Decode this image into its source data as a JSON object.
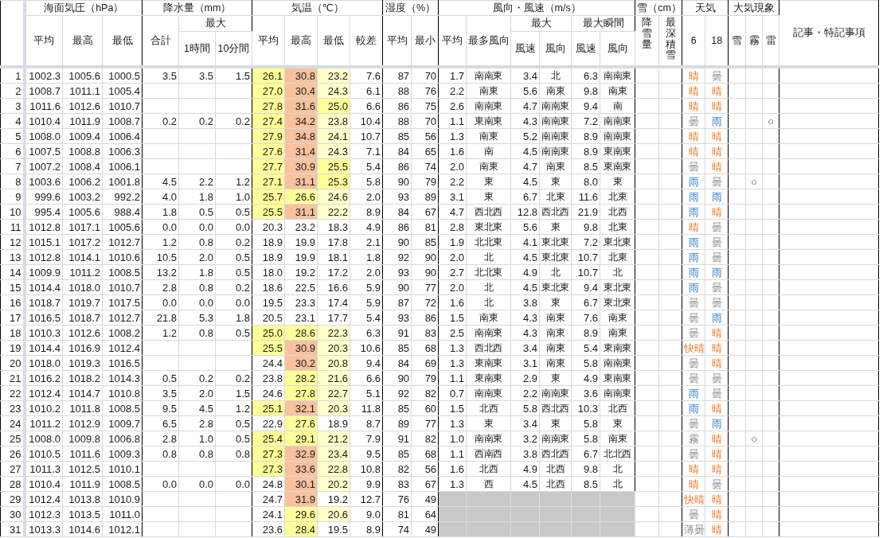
{
  "columns": {
    "pressure": {
      "title": "海面気圧（hPa）",
      "sub": [
        "平均",
        "最高",
        "最低"
      ]
    },
    "precipitation": {
      "title": "降水量（mm）",
      "total": "合計",
      "max": {
        "title": "最大",
        "sub": [
          "1時間",
          "10分間"
        ]
      }
    },
    "temperature": {
      "title": "気温（℃）",
      "sub": [
        "平均",
        "最高",
        "最低",
        "較差"
      ]
    },
    "humidity": {
      "title": "湿度（%）",
      "sub": [
        "平均",
        "最小"
      ]
    },
    "wind": {
      "title": "風向・風速（m/s）",
      "average": "平均",
      "prevailing": "最多風向",
      "max": {
        "title": "最大",
        "sub": [
          "風速",
          "風向"
        ]
      },
      "gust": {
        "title": "最大瞬間",
        "sub": [
          "風速",
          "風向"
        ]
      }
    },
    "snow": {
      "title": "雪（cm）",
      "sub": [
        "降雪量",
        "最深積雪"
      ]
    },
    "weather": {
      "title": "天気",
      "sub": [
        "6",
        "18"
      ]
    },
    "phenomena": {
      "title": "大気現象",
      "sub": [
        "雪",
        "霧",
        "雷"
      ]
    },
    "notes": {
      "title": "記事・特記事項"
    }
  },
  "rows": [
    {
      "day": "1",
      "pressure": [
        "1002.3",
        "1005.6",
        "1000.5"
      ],
      "precipitation": [
        "3.5",
        "3.5",
        "1.5"
      ],
      "temperature": [
        {
          "text": "26.1",
          "color": "#ffff99"
        },
        {
          "text": "30.8",
          "color": "#f8c29f"
        },
        {
          "text": "23.2",
          "color": "#ffffcc"
        },
        {
          "text": "7.6"
        }
      ],
      "humidity": [
        "87",
        "70"
      ],
      "wind_missing": false,
      "wind": [
        "1.7",
        "南南東",
        "3.4",
        "北",
        "6.3",
        "南南東"
      ],
      "weather": [
        {
          "text": "晴",
          "kind": "fair"
        },
        {
          "text": "曇",
          "kind": "cloudy"
        }
      ]
    },
    {
      "day": "2",
      "pressure": [
        "1008.7",
        "1011.1",
        "1005.4"
      ],
      "temperature": [
        {
          "text": "27.0",
          "color": "#ffff99"
        },
        {
          "text": "30.4",
          "color": "#f8c29f"
        },
        {
          "text": "24.3",
          "color": "#ffffcc"
        },
        {
          "text": "6.1"
        }
      ],
      "humidity": [
        "88",
        "76"
      ],
      "wind_missing": false,
      "wind": [
        "2.2",
        "南東",
        "5.6",
        "南東",
        "9.8",
        "南東"
      ],
      "weather": [
        {
          "text": "晴",
          "kind": "fair"
        },
        {
          "text": "晴",
          "kind": "fair"
        }
      ]
    },
    {
      "day": "3",
      "pressure": [
        "1011.6",
        "1012.6",
        "1010.7"
      ],
      "temperature": [
        {
          "text": "27.8",
          "color": "#ffff99"
        },
        {
          "text": "31.6",
          "color": "#f8c29f"
        },
        {
          "text": "25.0",
          "color": "#ffff99"
        },
        {
          "text": "6.6"
        }
      ],
      "humidity": [
        "86",
        "75"
      ],
      "wind_missing": false,
      "wind": [
        "2.6",
        "南南東",
        "4.7",
        "南南東",
        "9.4",
        "南"
      ],
      "weather": [
        {
          "text": "晴",
          "kind": "fair"
        },
        {
          "text": "晴",
          "kind": "fair"
        }
      ]
    },
    {
      "day": "4",
      "pressure": [
        "1010.4",
        "1011.9",
        "1008.7"
      ],
      "precipitation": [
        "0.2",
        "0.2",
        "0.2"
      ],
      "temperature": [
        {
          "text": "27.4",
          "color": "#ffff99"
        },
        {
          "text": "34.2",
          "color": "#f8c29f"
        },
        {
          "text": "23.8",
          "color": "#ffffcc"
        },
        {
          "text": "10.4"
        }
      ],
      "humidity": [
        "88",
        "70"
      ],
      "wind_missing": false,
      "wind": [
        "1.1",
        "東南東",
        "4.3",
        "南南東",
        "7.2",
        "南南東"
      ],
      "weather": [
        {
          "text": "曇",
          "kind": "cloudy"
        },
        {
          "text": "雨",
          "kind": "rain"
        }
      ],
      "phenomena": {
        "thunder": "○"
      }
    },
    {
      "day": "5",
      "pressure": [
        "1008.0",
        "1009.4",
        "1006.4"
      ],
      "temperature": [
        {
          "text": "27.9",
          "color": "#ffff99"
        },
        {
          "text": "34.8",
          "color": "#f8c29f"
        },
        {
          "text": "24.1",
          "color": "#ffffcc"
        },
        {
          "text": "10.7"
        }
      ],
      "humidity": [
        "85",
        "56"
      ],
      "wind_missing": false,
      "wind": [
        "1.3",
        "南東",
        "5.2",
        "南南東",
        "8.9",
        "南南東"
      ],
      "weather": [
        {
          "text": "晴",
          "kind": "fair"
        },
        {
          "text": "晴",
          "kind": "fair"
        }
      ]
    },
    {
      "day": "6",
      "pressure": [
        "1007.5",
        "1008.8",
        "1006.3"
      ],
      "temperature": [
        {
          "text": "27.6",
          "color": "#ffff99"
        },
        {
          "text": "31.4",
          "color": "#f8c29f"
        },
        {
          "text": "24.3",
          "color": "#ffffcc"
        },
        {
          "text": "7.1"
        }
      ],
      "humidity": [
        "84",
        "65"
      ],
      "wind_missing": false,
      "wind": [
        "1.6",
        "南",
        "4.5",
        "南南東",
        "8.9",
        "東南東"
      ],
      "weather": [
        {
          "text": "晴",
          "kind": "fair"
        },
        {
          "text": "晴",
          "kind": "fair"
        }
      ]
    },
    {
      "day": "7",
      "pressure": [
        "1007.2",
        "1008.4",
        "1006.1"
      ],
      "temperature": [
        {
          "text": "27.7",
          "color": "#ffff99"
        },
        {
          "text": "30.9",
          "color": "#f8c29f"
        },
        {
          "text": "25.5",
          "color": "#ffff99"
        },
        {
          "text": "5.4"
        }
      ],
      "humidity": [
        "86",
        "74"
      ],
      "wind_missing": false,
      "wind": [
        "2.0",
        "南東",
        "4.7",
        "南東",
        "8.5",
        "東南東"
      ],
      "weather": [
        {
          "text": "曇",
          "kind": "cloudy"
        },
        {
          "text": "晴",
          "kind": "fair"
        }
      ]
    },
    {
      "day": "8",
      "pressure": [
        "1003.6",
        "1006.2",
        "1001.8"
      ],
      "precipitation": [
        "4.5",
        "2.2",
        "1.2"
      ],
      "temperature": [
        {
          "text": "27.1",
          "color": "#ffff99"
        },
        {
          "text": "31.1",
          "color": "#f8c29f"
        },
        {
          "text": "25.3",
          "color": "#ffff99"
        },
        {
          "text": "5.8"
        }
      ],
      "humidity": [
        "90",
        "79"
      ],
      "wind_missing": false,
      "wind": [
        "2.2",
        "東",
        "4.5",
        "東",
        "8.0",
        "東"
      ],
      "weather": [
        {
          "text": "雨",
          "kind": "rain"
        },
        {
          "text": "曇",
          "kind": "cloudy"
        }
      ],
      "phenomena": {
        "fog": "○"
      }
    },
    {
      "day": "9",
      "pressure": [
        "999.6",
        "1003.2",
        "992.2"
      ],
      "precipitation": [
        "4.0",
        "1.8",
        "1.0"
      ],
      "temperature": [
        {
          "text": "25.7",
          "color": "#ffff99"
        },
        {
          "text": "26.6",
          "color": "#ffff99"
        },
        {
          "text": "24.6",
          "color": "#ffffcc"
        },
        {
          "text": "2.0"
        }
      ],
      "humidity": [
        "93",
        "89"
      ],
      "wind_missing": false,
      "wind": [
        "3.1",
        "東",
        "6.7",
        "北東",
        "11.6",
        "北東"
      ],
      "weather": [
        {
          "text": "雨",
          "kind": "rain"
        },
        {
          "text": "雨",
          "kind": "rain"
        }
      ]
    },
    {
      "day": "10",
      "pressure": [
        "995.4",
        "1005.6",
        "988.4"
      ],
      "precipitation": [
        "1.8",
        "0.5",
        "0.5"
      ],
      "temperature": [
        {
          "text": "25.5",
          "color": "#ffff99"
        },
        {
          "text": "31.1",
          "color": "#f8c29f"
        },
        {
          "text": "22.2",
          "color": "#ffffcc"
        },
        {
          "text": "8.9"
        }
      ],
      "humidity": [
        "84",
        "67"
      ],
      "wind_missing": false,
      "wind": [
        "4.7",
        "西北西",
        "12.8",
        "西北西",
        "21.9",
        "北西"
      ],
      "weather": [
        {
          "text": "雨",
          "kind": "rain"
        },
        {
          "text": "晴",
          "kind": "fair"
        }
      ]
    },
    {
      "day": "11",
      "pressure": [
        "1012.8",
        "1017.1",
        "1005.6"
      ],
      "precipitation": [
        "0.0",
        "0.0",
        "0.0"
      ],
      "temperature": [
        {
          "text": "20.3"
        },
        {
          "text": "23.2"
        },
        {
          "text": "18.3"
        },
        {
          "text": "4.9"
        }
      ],
      "humidity": [
        "86",
        "81"
      ],
      "wind_missing": false,
      "wind": [
        "2.8",
        "東北東",
        "5.6",
        "東",
        "9.8",
        "北東"
      ],
      "weather": [
        {
          "text": "晴",
          "kind": "fair"
        },
        {
          "text": "曇",
          "kind": "cloudy"
        }
      ]
    },
    {
      "day": "12",
      "pressure": [
        "1015.1",
        "1017.2",
        "1012.7"
      ],
      "precipitation": [
        "1.2",
        "0.8",
        "0.2"
      ],
      "temperature": [
        {
          "text": "18.9"
        },
        {
          "text": "19.9"
        },
        {
          "text": "17.8"
        },
        {
          "text": "2.1"
        }
      ],
      "humidity": [
        "90",
        "85"
      ],
      "wind_missing": false,
      "wind": [
        "1.9",
        "北北東",
        "4.1",
        "東北東",
        "7.2",
        "東北東"
      ],
      "weather": [
        {
          "text": "雨",
          "kind": "rain"
        },
        {
          "text": "曇",
          "kind": "cloudy"
        }
      ]
    },
    {
      "day": "13",
      "pressure": [
        "1012.8",
        "1014.1",
        "1010.6"
      ],
      "precipitation": [
        "10.5",
        "2.0",
        "0.5"
      ],
      "temperature": [
        {
          "text": "18.9"
        },
        {
          "text": "19.9"
        },
        {
          "text": "18.1"
        },
        {
          "text": "1.8"
        }
      ],
      "humidity": [
        "92",
        "90"
      ],
      "wind_missing": false,
      "wind": [
        "2.0",
        "北",
        "4.5",
        "東北東",
        "10.7",
        "北東"
      ],
      "weather": [
        {
          "text": "雨",
          "kind": "rain"
        },
        {
          "text": "曇",
          "kind": "cloudy"
        }
      ]
    },
    {
      "day": "14",
      "pressure": [
        "1009.9",
        "1011.2",
        "1008.5"
      ],
      "precipitation": [
        "13.2",
        "1.8",
        "0.5"
      ],
      "temperature": [
        {
          "text": "18.0"
        },
        {
          "text": "19.2"
        },
        {
          "text": "17.2"
        },
        {
          "text": "2.0"
        }
      ],
      "humidity": [
        "93",
        "90"
      ],
      "wind_missing": false,
      "wind": [
        "2.7",
        "北北東",
        "4.9",
        "北",
        "10.7",
        "北"
      ],
      "weather": [
        {
          "text": "雨",
          "kind": "rain"
        },
        {
          "text": "雨",
          "kind": "rain"
        }
      ]
    },
    {
      "day": "15",
      "pressure": [
        "1014.4",
        "1018.0",
        "1010.7"
      ],
      "precipitation": [
        "2.8",
        "0.8",
        "0.2"
      ],
      "temperature": [
        {
          "text": "18.6"
        },
        {
          "text": "22.5"
        },
        {
          "text": "16.6"
        },
        {
          "text": "5.9"
        }
      ],
      "humidity": [
        "90",
        "77"
      ],
      "wind_missing": false,
      "wind": [
        "2.0",
        "北",
        "4.5",
        "東北東",
        "9.4",
        "東北東"
      ],
      "weather": [
        {
          "text": "雨",
          "kind": "rain"
        },
        {
          "text": "曇",
          "kind": "cloudy"
        }
      ]
    },
    {
      "day": "16",
      "pressure": [
        "1018.7",
        "1019.7",
        "1017.5"
      ],
      "precipitation": [
        "0.0",
        "0.0",
        "0.0"
      ],
      "temperature": [
        {
          "text": "19.5"
        },
        {
          "text": "23.3"
        },
        {
          "text": "17.4"
        },
        {
          "text": "5.9"
        }
      ],
      "humidity": [
        "87",
        "72"
      ],
      "wind_missing": false,
      "wind": [
        "1.6",
        "北",
        "3.8",
        "東",
        "6.7",
        "東北東"
      ],
      "weather": [
        {
          "text": "曇",
          "kind": "cloudy"
        },
        {
          "text": "曇",
          "kind": "cloudy"
        }
      ]
    },
    {
      "day": "17",
      "pressure": [
        "1016.5",
        "1018.7",
        "1012.7"
      ],
      "precipitation": [
        "21.8",
        "5.3",
        "1.8"
      ],
      "temperature": [
        {
          "text": "20.5"
        },
        {
          "text": "23.1"
        },
        {
          "text": "17.7"
        },
        {
          "text": "5.4"
        }
      ],
      "humidity": [
        "93",
        "86"
      ],
      "wind_missing": false,
      "wind": [
        "1.5",
        "南東",
        "4.3",
        "南東",
        "7.6",
        "南東"
      ],
      "weather": [
        {
          "text": "曇",
          "kind": "cloudy"
        },
        {
          "text": "雨",
          "kind": "rain"
        }
      ]
    },
    {
      "day": "18",
      "pressure": [
        "1010.3",
        "1012.6",
        "1008.2"
      ],
      "precipitation": [
        "1.2",
        "0.8",
        "0.5"
      ],
      "temperature": [
        {
          "text": "25.0",
          "color": "#ffff99"
        },
        {
          "text": "28.6",
          "color": "#ffff99"
        },
        {
          "text": "22.3",
          "color": "#ffffcc"
        },
        {
          "text": "6.3"
        }
      ],
      "humidity": [
        "91",
        "83"
      ],
      "wind_missing": false,
      "wind": [
        "2.5",
        "南南東",
        "4.3",
        "南東",
        "8.9",
        "南東"
      ],
      "weather": [
        {
          "text": "曇",
          "kind": "cloudy"
        },
        {
          "text": "晴",
          "kind": "fair"
        }
      ]
    },
    {
      "day": "19",
      "pressure": [
        "1014.4",
        "1016.9",
        "1012.4"
      ],
      "temperature": [
        {
          "text": "25.5",
          "color": "#ffff99"
        },
        {
          "text": "30.9",
          "color": "#f8c29f"
        },
        {
          "text": "20.3",
          "color": "#ffffcc"
        },
        {
          "text": "10.6"
        }
      ],
      "humidity": [
        "85",
        "68"
      ],
      "wind_missing": false,
      "wind": [
        "1.3",
        "西北西",
        "3.4",
        "南東",
        "5.4",
        "東南東"
      ],
      "weather": [
        {
          "text": "快晴",
          "kind": "fair"
        },
        {
          "text": "晴",
          "kind": "fair"
        }
      ]
    },
    {
      "day": "20",
      "pressure": [
        "1018.0",
        "1019.3",
        "1016.5"
      ],
      "temperature": [
        {
          "text": "24.4"
        },
        {
          "text": "30.2",
          "color": "#f8c29f"
        },
        {
          "text": "20.8",
          "color": "#ffffcc"
        },
        {
          "text": "9.4"
        }
      ],
      "humidity": [
        "84",
        "69"
      ],
      "wind_missing": false,
      "wind": [
        "1.3",
        "東南東",
        "3.1",
        "南東",
        "5.8",
        "南南東"
      ],
      "weather": [
        {
          "text": "曇",
          "kind": "cloudy"
        },
        {
          "text": "晴",
          "kind": "fair"
        }
      ]
    },
    {
      "day": "21",
      "pressure": [
        "1016.2",
        "1018.2",
        "1014.3"
      ],
      "precipitation": [
        "0.5",
        "0.2",
        "0.2"
      ],
      "temperature": [
        {
          "text": "23.8"
        },
        {
          "text": "28.2",
          "color": "#ffff99"
        },
        {
          "text": "21.6",
          "color": "#ffffcc"
        },
        {
          "text": "6.6"
        }
      ],
      "humidity": [
        "90",
        "79"
      ],
      "wind_missing": false,
      "wind": [
        "1.1",
        "東南東",
        "2.9",
        "東",
        "4.9",
        "東南東"
      ],
      "weather": [
        {
          "text": "曇",
          "kind": "cloudy"
        },
        {
          "text": "曇",
          "kind": "cloudy"
        }
      ]
    },
    {
      "day": "22",
      "pressure": [
        "1012.4",
        "1014.7",
        "1010.8"
      ],
      "precipitation": [
        "3.5",
        "2.0",
        "1.5"
      ],
      "temperature": [
        {
          "text": "24.6"
        },
        {
          "text": "27.8",
          "color": "#ffff99"
        },
        {
          "text": "22.7",
          "color": "#ffffcc"
        },
        {
          "text": "5.1"
        }
      ],
      "humidity": [
        "92",
        "82"
      ],
      "wind_missing": false,
      "wind": [
        "0.7",
        "南南東",
        "2.2",
        "南南東",
        "3.6",
        "南南東"
      ],
      "weather": [
        {
          "text": "雨",
          "kind": "rain"
        },
        {
          "text": "曇",
          "kind": "cloudy"
        }
      ]
    },
    {
      "day": "23",
      "pressure": [
        "1010.2",
        "1011.8",
        "1008.5"
      ],
      "precipitation": [
        "9.5",
        "4.5",
        "1.2"
      ],
      "temperature": [
        {
          "text": "25.1",
          "color": "#ffff99"
        },
        {
          "text": "32.1",
          "color": "#f8c29f"
        },
        {
          "text": "20.3",
          "color": "#ffffcc"
        },
        {
          "text": "11.8"
        }
      ],
      "humidity": [
        "85",
        "60"
      ],
      "wind_missing": false,
      "wind": [
        "1.5",
        "北西",
        "5.8",
        "西北西",
        "10.3",
        "北西"
      ],
      "weather": [
        {
          "text": "雨",
          "kind": "rain"
        },
        {
          "text": "晴",
          "kind": "fair"
        }
      ]
    },
    {
      "day": "24",
      "pressure": [
        "1011.2",
        "1012.9",
        "1009.7"
      ],
      "precipitation": [
        "6.5",
        "2.8",
        "0.5"
      ],
      "temperature": [
        {
          "text": "22.9"
        },
        {
          "text": "27.6",
          "color": "#ffff99"
        },
        {
          "text": "18.9"
        },
        {
          "text": "8.7"
        }
      ],
      "humidity": [
        "89",
        "77"
      ],
      "wind_missing": false,
      "wind": [
        "1.3",
        "東",
        "3.4",
        "東",
        "5.8",
        "東"
      ],
      "weather": [
        {
          "text": "曇",
          "kind": "cloudy"
        },
        {
          "text": "雨",
          "kind": "rain"
        }
      ]
    },
    {
      "day": "25",
      "pressure": [
        "1008.0",
        "1009.8",
        "1006.8"
      ],
      "precipitation": [
        "2.8",
        "1.0",
        "0.5"
      ],
      "temperature": [
        {
          "text": "25.4",
          "color": "#ffff99"
        },
        {
          "text": "29.1",
          "color": "#ffff99"
        },
        {
          "text": "21.2",
          "color": "#ffffcc"
        },
        {
          "text": "7.9"
        }
      ],
      "humidity": [
        "91",
        "82"
      ],
      "wind_missing": false,
      "wind": [
        "1.0",
        "南南東",
        "3.2",
        "南南東",
        "5.8",
        "南東"
      ],
      "weather": [
        {
          "text": "霧",
          "kind": "cloudy"
        },
        {
          "text": "晴",
          "kind": "fair"
        }
      ],
      "phenomena": {
        "fog": "○"
      }
    },
    {
      "day": "26",
      "pressure": [
        "1010.5",
        "1011.6",
        "1009.3"
      ],
      "precipitation": [
        "0.8",
        "0.8",
        "0.8"
      ],
      "temperature": [
        {
          "text": "27.3",
          "color": "#ffff99"
        },
        {
          "text": "32.9",
          "color": "#f8c29f"
        },
        {
          "text": "23.4",
          "color": "#ffffcc"
        },
        {
          "text": "9.5"
        }
      ],
      "humidity": [
        "85",
        "68"
      ],
      "wind_missing": false,
      "wind": [
        "1.1",
        "西南西",
        "3.8",
        "西北西",
        "6.7",
        "北北西"
      ],
      "weather": [
        {
          "text": "曇",
          "kind": "cloudy"
        },
        {
          "text": "晴",
          "kind": "fair"
        }
      ]
    },
    {
      "day": "27",
      "pressure": [
        "1011.3",
        "1012.5",
        "1010.1"
      ],
      "temperature": [
        {
          "text": "27.3",
          "color": "#ffff99"
        },
        {
          "text": "33.6",
          "color": "#f8c29f"
        },
        {
          "text": "22.8",
          "color": "#ffffcc"
        },
        {
          "text": "10.8"
        }
      ],
      "humidity": [
        "82",
        "56"
      ],
      "wind_missing": false,
      "wind": [
        "1.6",
        "北西",
        "4.9",
        "北西",
        "9.8",
        "北"
      ],
      "weather": [
        {
          "text": "晴",
          "kind": "fair"
        },
        {
          "text": "晴",
          "kind": "fair"
        }
      ]
    },
    {
      "day": "28",
      "pressure": [
        "1010.4",
        "1011.9",
        "1008.5"
      ],
      "precipitation": [
        "0.0",
        "0.0",
        "0.0"
      ],
      "temperature": [
        {
          "text": "24.8"
        },
        {
          "text": "30.1",
          "color": "#f8c29f"
        },
        {
          "text": "20.2",
          "color": "#ffffcc"
        },
        {
          "text": "9.9"
        }
      ],
      "humidity": [
        "83",
        "67"
      ],
      "wind_missing": false,
      "wind": [
        "1.3",
        "西",
        "4.5",
        "北西",
        "8.5",
        "北"
      ],
      "weather": [
        {
          "text": "晴",
          "kind": "fair"
        },
        {
          "text": "曇",
          "kind": "cloudy"
        }
      ]
    },
    {
      "day": "29",
      "pressure": [
        "1012.4",
        "1013.8",
        "1010.9"
      ],
      "temperature": [
        {
          "text": "24.7"
        },
        {
          "text": "31.9",
          "color": "#f8c29f"
        },
        {
          "text": "19.2"
        },
        {
          "text": "12.7"
        }
      ],
      "humidity": [
        "76",
        "49"
      ],
      "wind_missing": true,
      "weather": [
        {
          "text": "快晴",
          "kind": "fair"
        },
        {
          "text": "晴",
          "kind": "fair"
        }
      ]
    },
    {
      "day": "30",
      "pressure": [
        "1012.3",
        "1013.5",
        "1011.0"
      ],
      "temperature": [
        {
          "text": "24.1"
        },
        {
          "text": "29.6",
          "color": "#ffff99"
        },
        {
          "text": "20.6",
          "color": "#ffffcc"
        },
        {
          "text": "9.0"
        }
      ],
      "humidity": [
        "81",
        "64"
      ],
      "wind_missing": true,
      "weather": [
        {
          "text": "曇",
          "kind": "cloudy"
        },
        {
          "text": "晴",
          "kind": "fair"
        }
      ]
    },
    {
      "day": "31",
      "pressure": [
        "1013.3",
        "1014.6",
        "1012.1"
      ],
      "temperature": [
        {
          "text": "23.6"
        },
        {
          "text": "28.4",
          "color": "#ffff99"
        },
        {
          "text": "19.5"
        },
        {
          "text": "8.9"
        }
      ],
      "humidity": [
        "74",
        "49"
      ],
      "wind_missing": true,
      "weather": [
        {
          "text": "薄曇",
          "kind": "cloudy"
        },
        {
          "text": "晴",
          "kind": "fair"
        }
      ]
    }
  ]
}
